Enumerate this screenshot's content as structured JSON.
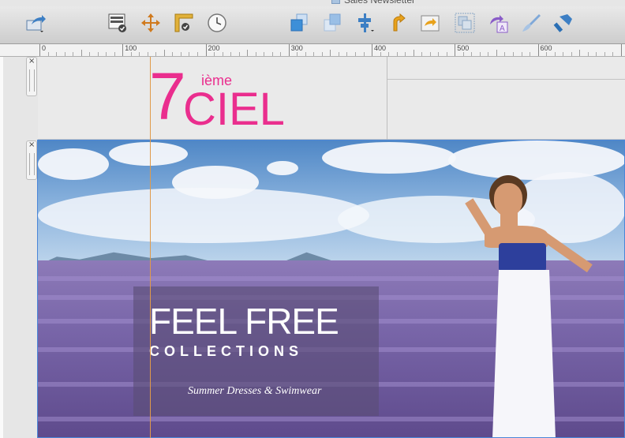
{
  "window": {
    "title": "Sales Newsletter"
  },
  "toolbar": {
    "items": [
      {
        "name": "share-icon",
        "color": "#3d7fc4"
      },
      {
        "name": "checklist-icon",
        "color": "#555555"
      },
      {
        "name": "move-icon",
        "color": "#d07a1e"
      },
      {
        "name": "ruler-check-icon",
        "color": "#d9a520"
      },
      {
        "name": "clock-icon",
        "color": "#888888"
      },
      {
        "name": "bring-front-icon",
        "color": "#3d8fd8"
      },
      {
        "name": "send-back-icon",
        "color": "#9abfe6"
      },
      {
        "name": "align-icon",
        "color": "#3d7fc4"
      },
      {
        "name": "rotate-icon",
        "color": "#e8a21c"
      },
      {
        "name": "flip-icon",
        "color": "#e8a21c"
      },
      {
        "name": "group-icon",
        "color": "#8aa6c4"
      },
      {
        "name": "text-style-icon",
        "color": "#8a5cc8"
      },
      {
        "name": "brush-icon",
        "color": "#7fa8d8"
      },
      {
        "name": "paint-icon",
        "color": "#3d7fc4"
      }
    ]
  },
  "ruler": {
    "labels": [
      "0",
      "100",
      "200",
      "300",
      "400",
      "500",
      "600"
    ]
  },
  "logo": {
    "number": "7",
    "superscript": "ième",
    "word": "CIEL",
    "color": "#ea2e8e"
  },
  "hero": {
    "headline": "FEEL FREE",
    "subhead": "COLLECTIONS",
    "tagline": "Summer Dresses & Swimwear"
  },
  "handles": {
    "close_label": "×"
  }
}
